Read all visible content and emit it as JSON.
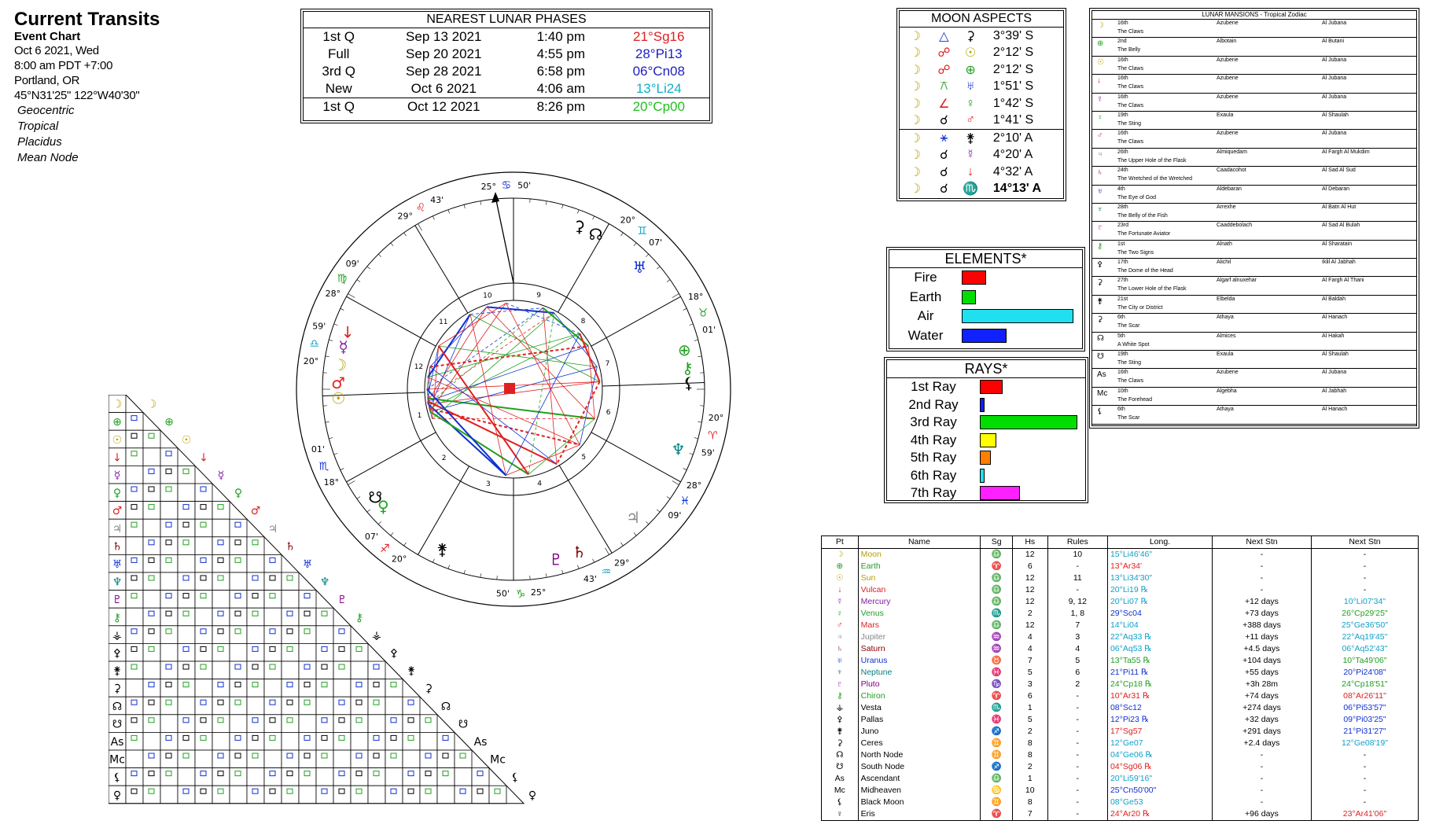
{
  "header": {
    "title": "Current Transits",
    "subtitle": "Event Chart",
    "date": "Oct 6 2021, Wed",
    "time": "8:00 am  PDT +7:00",
    "place": "Portland, OR",
    "coords": "45°N31'25\"  122°W40'30\"",
    "settings": [
      "Geocentric",
      "Tropical",
      "Placidus",
      "Mean Node"
    ]
  },
  "phases": {
    "title": "NEAREST LUNAR PHASES",
    "rows": [
      {
        "phase": "1st Q",
        "date": "Sep 13 2021",
        "time": "1:40 pm",
        "pos": "21°Sg16",
        "color": "#e02020"
      },
      {
        "phase": "Full",
        "date": "Sep 20 2021",
        "time": "4:55 pm",
        "pos": "28°Pi13",
        "color": "#2020c0"
      },
      {
        "phase": "3rd Q",
        "date": "Sep 28 2021",
        "time": "6:58 pm",
        "pos": "06°Cn08",
        "color": "#2020c0"
      },
      {
        "phase": "New",
        "date": "Oct 6 2021",
        "time": "4:06 am",
        "pos": "13°Li24",
        "color": "#10b0c8"
      },
      {
        "phase": "1st Q",
        "date": "Oct 12 2021",
        "time": "8:26 pm",
        "pos": "20°Cp00",
        "color": "#20c020"
      }
    ]
  },
  "aspects": {
    "title": "MOON ASPECTS",
    "rows": [
      {
        "p1": "☽",
        "asp": "△",
        "p2": "⚳",
        "orb": "3°39' S",
        "c1": "#b8a000",
        "ca": "#1030d0",
        "c2": "#000"
      },
      {
        "p1": "☽",
        "asp": "☍",
        "p2": "☉",
        "orb": "2°12' S",
        "c1": "#b8a000",
        "ca": "#e02020",
        "c2": "#b8a000"
      },
      {
        "p1": "☽",
        "asp": "☍",
        "p2": "⊕",
        "orb": "2°12' S",
        "c1": "#b8a000",
        "ca": "#e02020",
        "c2": "#20a020"
      },
      {
        "p1": "☽",
        "asp": "⚻",
        "p2": "♅",
        "orb": "1°51' S",
        "c1": "#b8a000",
        "ca": "#20a020",
        "c2": "#1030d0"
      },
      {
        "p1": "☽",
        "asp": "∠",
        "p2": "♀",
        "orb": "1°42' S",
        "c1": "#b8a000",
        "ca": "#e02020",
        "c2": "#20a020"
      },
      {
        "p1": "☽",
        "asp": "☌",
        "p2": "♂",
        "orb": "1°41' S",
        "c1": "#b8a000",
        "ca": "#000",
        "c2": "#e02020"
      },
      {
        "p1": "☽",
        "asp": "⚹",
        "p2": "⚵",
        "orb": "2°10' A",
        "c1": "#b8a000",
        "ca": "#1030d0",
        "c2": "#000"
      },
      {
        "p1": "☽",
        "asp": "☌",
        "p2": "☿",
        "orb": "4°20' A",
        "c1": "#b8a000",
        "ca": "#000",
        "c2": "#8020a0"
      },
      {
        "p1": "☽",
        "asp": "☌",
        "p2": "↓",
        "orb": "4°32' A",
        "c1": "#b8a000",
        "ca": "#000",
        "c2": "#e02020"
      },
      {
        "p1": "☽",
        "asp": "☌",
        "p2": "♏",
        "orb": "14°13' A",
        "c1": "#b8a000",
        "ca": "#000",
        "c2": "#1030d0",
        "bold": true
      }
    ]
  },
  "elements": {
    "title": "ELEMENTS*",
    "items": [
      {
        "label": "Fire",
        "value": 0.22,
        "color": "#ff0000"
      },
      {
        "label": "Earth",
        "value": 0.13,
        "color": "#00dd00"
      },
      {
        "label": "Air",
        "value": 1.0,
        "color": "#20e0f0"
      },
      {
        "label": "Water",
        "value": 0.4,
        "color": "#1020ff"
      }
    ]
  },
  "rays": {
    "title": "RAYS*",
    "items": [
      {
        "label": "1st Ray",
        "value": 0.23,
        "color": "#ff0000"
      },
      {
        "label": "2nd Ray",
        "value": 0.05,
        "color": "#1020ff"
      },
      {
        "label": "3rd Ray",
        "value": 1.0,
        "color": "#00dd00"
      },
      {
        "label": "4th Ray",
        "value": 0.17,
        "color": "#ffff00"
      },
      {
        "label": "5th Ray",
        "value": 0.11,
        "color": "#ff8000"
      },
      {
        "label": "6th Ray",
        "value": 0.05,
        "color": "#20e0f0"
      },
      {
        "label": "7th Ray",
        "value": 0.41,
        "color": "#ff20ff"
      }
    ]
  },
  "mansions": {
    "title": "LUNAR MANSIONS - Tropical Zodiac",
    "rows": [
      {
        "g": "☽",
        "n": "16th",
        "a": "Azubene",
        "b": "Al Jubana",
        "d": "The Claws",
        "c": "#b8a000"
      },
      {
        "g": "⊕",
        "n": "2nd",
        "a": "Albotain",
        "b": "Al Butani",
        "d": "The Belly",
        "c": "#20a020"
      },
      {
        "g": "☉",
        "n": "16th",
        "a": "Azubene",
        "b": "Al Jubana",
        "d": "The Claws",
        "c": "#b8a000"
      },
      {
        "g": "↓",
        "n": "16th",
        "a": "Azubene",
        "b": "Al Jubana",
        "d": "The Claws",
        "c": "#e02020"
      },
      {
        "g": "☿",
        "n": "16th",
        "a": "Azubene",
        "b": "Al Jubana",
        "d": "The Claws",
        "c": "#8020a0"
      },
      {
        "g": "♀",
        "n": "19th",
        "a": "Exaula",
        "b": "Al Shaulah",
        "d": "The Sting",
        "c": "#20a020"
      },
      {
        "g": "♂",
        "n": "16th",
        "a": "Azubene",
        "b": "Al Jubana",
        "d": "The Claws",
        "c": "#e02020"
      },
      {
        "g": "♃",
        "n": "26th",
        "a": "Almiquedam",
        "b": "Al Fargh Al Mukdim",
        "d": "The Upper Hole of the Flask",
        "c": "#888"
      },
      {
        "g": "♄",
        "n": "24th",
        "a": "Caadacohot",
        "b": "Al Sad Al Sud",
        "d": "The Wretched of the Wretched",
        "c": "#800000"
      },
      {
        "g": "♅",
        "n": "4th",
        "a": "Aldebaran",
        "b": "Al Debaran",
        "d": "The Eye of God",
        "c": "#1030d0"
      },
      {
        "g": "♆",
        "n": "28th",
        "a": "Arrexhe",
        "b": "Al Batn Al Hut",
        "d": "The Belly of the Fish",
        "c": "#008080"
      },
      {
        "g": "♇",
        "n": "23rd",
        "a": "Caaddebolach",
        "b": "Al Sad Al Bulah",
        "d": "The Fortunate Aviator",
        "c": "#800080"
      },
      {
        "g": "⚷",
        "n": "1st",
        "a": "Alnath",
        "b": "Al Sharatain",
        "d": "The Two Signs",
        "c": "#20a020"
      },
      {
        "g": "⚴",
        "n": "17th",
        "a": "Alichil",
        "b": "Iklil Al Jabhah",
        "d": "The Dome of the Head",
        "c": "#000"
      },
      {
        "g": "⚳",
        "n": "27th",
        "a": "Algarf alnuxehar",
        "b": "Al Fargh Al Thani",
        "d": "The Lower Hole of the Flask",
        "c": "#000"
      },
      {
        "g": "⚵",
        "n": "21st",
        "a": "Elbelda",
        "b": "Al Baldah",
        "d": "The City or District",
        "c": "#000"
      },
      {
        "g": "⚳",
        "n": "6th",
        "a": "Athaya",
        "b": "Al Hanach",
        "d": "The Scar",
        "c": "#000"
      },
      {
        "g": "☊",
        "n": "5th",
        "a": "Almices",
        "b": "Al Hakah",
        "d": "A White Spot",
        "c": "#000"
      },
      {
        "g": "☋",
        "n": "19th",
        "a": "Exaula",
        "b": "Al Shaulah",
        "d": "The Sting",
        "c": "#000"
      },
      {
        "g": "As",
        "n": "16th",
        "a": "Azubene",
        "b": "Al Jubana",
        "d": "The Claws",
        "c": "#000"
      },
      {
        "g": "Mc",
        "n": "10th",
        "a": "Algebha",
        "b": "Al Jabhah",
        "d": "The Forehead",
        "c": "#000"
      },
      {
        "g": "⚸",
        "n": "6th",
        "a": "Athaya",
        "b": "Al Hanach",
        "d": "The Scar",
        "c": "#000"
      },
      {
        "g": "♀",
        "n": "2nd",
        "a": "Albotain",
        "b": "Al Butani",
        "d": "The Belly",
        "c": "#000"
      }
    ]
  },
  "planet_table": {
    "headers": [
      "Pt",
      "Name",
      "Sg",
      "Hs",
      "Rules",
      "Long.",
      "Next Stn",
      "Next Stn"
    ],
    "rows": [
      {
        "g": "☽",
        "name": "Moon",
        "sg": "♎",
        "hs": "12",
        "rules": "10",
        "long": "15°Li46'46\"",
        "ns1": "-",
        "ns2": "-",
        "c": "#b8a000",
        "lc": "#10a0c8"
      },
      {
        "g": "⊕",
        "name": "Earth",
        "sg": "♈",
        "hs": "6",
        "rules": "-",
        "long": "13°Ar34'",
        "ns1": "-",
        "ns2": "-",
        "c": "#20a020",
        "lc": "#e02020"
      },
      {
        "g": "☉",
        "name": "Sun",
        "sg": "♎",
        "hs": "12",
        "rules": "11",
        "long": "13°Li34'30\"",
        "ns1": "-",
        "ns2": "-",
        "c": "#b8a000",
        "lc": "#10a0c8"
      },
      {
        "g": "↓",
        "name": "Vulcan",
        "sg": "♎",
        "hs": "12",
        "rules": "-",
        "long": "20°Li19 ℞",
        "ns1": "-",
        "ns2": "-",
        "c": "#e02020",
        "lc": "#10a0c8"
      },
      {
        "g": "☿",
        "name": "Mercury",
        "sg": "♎",
        "hs": "12",
        "rules": "9, 12",
        "long": "20°Li07 ℞",
        "ns1": "+12 days",
        "ns2": "10°Li07'34\"",
        "c": "#8020a0",
        "lc": "#10a0c8",
        "n2c": "#10a0c8"
      },
      {
        "g": "♀",
        "name": "Venus",
        "sg": "♏",
        "hs": "2",
        "rules": "1, 8",
        "long": "29°Sc04",
        "ns1": "+73 days",
        "ns2": "26°Cp29'25\"",
        "c": "#20a020",
        "lc": "#1030d0",
        "n2c": "#20a020"
      },
      {
        "g": "♂",
        "name": "Mars",
        "sg": "♎",
        "hs": "12",
        "rules": "7",
        "long": "14°Li04",
        "ns1": "+388 days",
        "ns2": "25°Ge36'50\"",
        "c": "#e02020",
        "lc": "#10a0c8",
        "n2c": "#10a0c8"
      },
      {
        "g": "♃",
        "name": "Jupiter",
        "sg": "♒",
        "hs": "4",
        "rules": "3",
        "long": "22°Aq33 ℞",
        "ns1": "+11 days",
        "ns2": "22°Aq19'45\"",
        "c": "#888",
        "lc": "#10a0c8",
        "n2c": "#10a0c8"
      },
      {
        "g": "♄",
        "name": "Saturn",
        "sg": "♒",
        "hs": "4",
        "rules": "4",
        "long": "06°Aq53 ℞",
        "ns1": "+4.5 days",
        "ns2": "06°Aq52'43\"",
        "c": "#800000",
        "lc": "#10a0c8",
        "n2c": "#10a0c8"
      },
      {
        "g": "♅",
        "name": "Uranus",
        "sg": "♉",
        "hs": "7",
        "rules": "5",
        "long": "13°Ta55 ℞",
        "ns1": "+104 days",
        "ns2": "10°Ta49'06\"",
        "c": "#1030d0",
        "lc": "#20a020",
        "n2c": "#20a020"
      },
      {
        "g": "♆",
        "name": "Neptune",
        "sg": "♓",
        "hs": "5",
        "rules": "6",
        "long": "21°Pi11 ℞",
        "ns1": "+55 days",
        "ns2": "20°Pi24'08\"",
        "c": "#008080",
        "lc": "#1030d0",
        "n2c": "#1030d0"
      },
      {
        "g": "♇",
        "name": "Pluto",
        "sg": "♑",
        "hs": "3",
        "rules": "2",
        "long": "24°Cp18 ℞",
        "ns1": "+3h 28m",
        "ns2": "24°Cp18'51\"",
        "c": "#800080",
        "lc": "#20a020",
        "n2c": "#20a020"
      },
      {
        "g": "⚷",
        "name": "Chiron",
        "sg": "♈",
        "hs": "6",
        "rules": "-",
        "long": "10°Ar31 ℞",
        "ns1": "+74 days",
        "ns2": "08°Ar26'11\"",
        "c": "#20a020",
        "lc": "#e02020",
        "n2c": "#e02020"
      },
      {
        "g": "⚶",
        "name": "Vesta",
        "sg": "♏",
        "hs": "1",
        "rules": "-",
        "long": "08°Sc12",
        "ns1": "+274 days",
        "ns2": "06°Pi53'57\"",
        "c": "#000",
        "lc": "#1030d0",
        "n2c": "#1030d0"
      },
      {
        "g": "⚴",
        "name": "Pallas",
        "sg": "♓",
        "hs": "5",
        "rules": "-",
        "long": "12°Pi23 ℞",
        "ns1": "+32 days",
        "ns2": "09°Pi03'25\"",
        "c": "#000",
        "lc": "#1030d0",
        "n2c": "#1030d0"
      },
      {
        "g": "⚵",
        "name": "Juno",
        "sg": "♐",
        "hs": "2",
        "rules": "-",
        "long": "17°Sg57",
        "ns1": "+291 days",
        "ns2": "21°Pi31'27\"",
        "c": "#000",
        "lc": "#e02020",
        "n2c": "#1030d0"
      },
      {
        "g": "⚳",
        "name": "Ceres",
        "sg": "♊",
        "hs": "8",
        "rules": "-",
        "long": "12°Ge07",
        "ns1": "+2.4 days",
        "ns2": "12°Ge08'19\"",
        "c": "#000",
        "lc": "#10a0c8",
        "n2c": "#10a0c8"
      },
      {
        "g": "☊",
        "name": "North Node",
        "sg": "♊",
        "hs": "8",
        "rules": "-",
        "long": "04°Ge06 ℞",
        "ns1": "-",
        "ns2": "-",
        "c": "#000",
        "lc": "#10a0c8"
      },
      {
        "g": "☋",
        "name": "South Node",
        "sg": "♐",
        "hs": "2",
        "rules": "-",
        "long": "04°Sg06 ℞",
        "ns1": "-",
        "ns2": "-",
        "c": "#000",
        "lc": "#e02020"
      },
      {
        "g": "As",
        "name": "Ascendant",
        "sg": "♎",
        "hs": "1",
        "rules": "-",
        "long": "20°Li59'16\"",
        "ns1": "-",
        "ns2": "-",
        "c": "#000",
        "lc": "#10a0c8"
      },
      {
        "g": "Mc",
        "name": "Midheaven",
        "sg": "♋",
        "hs": "10",
        "rules": "-",
        "long": "25°Cn50'00\"",
        "ns1": "-",
        "ns2": "-",
        "c": "#000",
        "lc": "#1030d0"
      },
      {
        "g": "⚸",
        "name": "Black Moon",
        "sg": "♊",
        "hs": "8",
        "rules": "-",
        "long": "08°Ge53",
        "ns1": "-",
        "ns2": "-",
        "c": "#000",
        "lc": "#10a0c8"
      },
      {
        "g": "♀",
        "name": "Eris",
        "sg": "♈",
        "hs": "7",
        "rules": "-",
        "long": "24°Ar20 ℞",
        "ns1": "+96 days",
        "ns2": "23°Ar41'06\"",
        "c": "#000",
        "lc": "#e02020",
        "n2c": "#e02020"
      }
    ]
  },
  "wheel": {
    "cusp_labels": [
      {
        "deg": "25°",
        "sign": "♋",
        "min": "50'",
        "c": "#1030d0"
      },
      {
        "deg": "20°",
        "sign": "♊",
        "min": "07'",
        "c": "#10a0c8"
      },
      {
        "deg": "18°",
        "sign": "♉",
        "min": "01'",
        "c": "#20a020"
      },
      {
        "deg": "20°",
        "sign": "♈",
        "min": "59'",
        "c": "#e02020"
      },
      {
        "deg": "28°",
        "sign": "♓",
        "min": "09'",
        "c": "#1030d0"
      },
      {
        "deg": "29°",
        "sign": "♒",
        "min": "43'",
        "c": "#10a0c8"
      },
      {
        "deg": "25°",
        "sign": "♑",
        "min": "50'",
        "c": "#20a020"
      },
      {
        "deg": "20°",
        "sign": "♐",
        "min": "07'",
        "c": "#e02020"
      },
      {
        "deg": "18°",
        "sign": "♏",
        "min": "01'",
        "c": "#1030d0"
      },
      {
        "deg": "20°",
        "sign": "♎",
        "min": "59'",
        "c": "#10a0c8"
      },
      {
        "deg": "28°",
        "sign": "♍",
        "min": "09'",
        "c": "#20a020"
      },
      {
        "deg": "29°",
        "sign": "♌",
        "min": "43'",
        "c": "#e02020"
      }
    ],
    "house_numbers": [
      "1",
      "2",
      "3",
      "4",
      "5",
      "6",
      "7",
      "8",
      "9",
      "10",
      "11",
      "12"
    ]
  },
  "aspect_grid": {
    "planets": [
      {
        "g": "☽",
        "c": "#b8a000"
      },
      {
        "g": "⊕",
        "c": "#20a020"
      },
      {
        "g": "☉",
        "c": "#b8a000"
      },
      {
        "g": "↓",
        "c": "#e02020"
      },
      {
        "g": "☿",
        "c": "#8020a0"
      },
      {
        "g": "♀",
        "c": "#20a020"
      },
      {
        "g": "♂",
        "c": "#e02020"
      },
      {
        "g": "♃",
        "c": "#888"
      },
      {
        "g": "♄",
        "c": "#800000"
      },
      {
        "g": "♅",
        "c": "#1030d0"
      },
      {
        "g": "♆",
        "c": "#008080"
      },
      {
        "g": "♇",
        "c": "#800080"
      },
      {
        "g": "⚷",
        "c": "#20a020"
      },
      {
        "g": "⚶",
        "c": "#000"
      },
      {
        "g": "⚴",
        "c": "#000"
      },
      {
        "g": "⚵",
        "c": "#000"
      },
      {
        "g": "⚳",
        "c": "#000"
      },
      {
        "g": "☊",
        "c": "#000"
      },
      {
        "g": "☋",
        "c": "#000"
      },
      {
        "g": "As",
        "c": "#000"
      },
      {
        "g": "Mc",
        "c": "#000"
      },
      {
        "g": "⚸",
        "c": "#000"
      },
      {
        "g": "♀",
        "c": "#000"
      }
    ]
  }
}
